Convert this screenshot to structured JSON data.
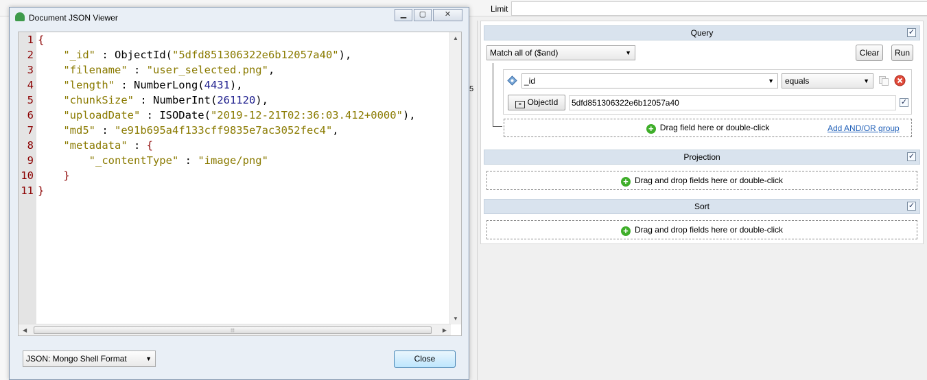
{
  "background": {
    "limit_label": "Limit",
    "mid_glyph": "5"
  },
  "query": {
    "section_label": "Query",
    "match_dropdown": "Match all of ($and)",
    "clear_label": "Clear",
    "run_label": "Run",
    "field_value": "_id",
    "operator_value": "equals",
    "type_button_label": "ObjectId",
    "value_text": "5dfd851306322e6b12057a40",
    "drag_field_text": "Drag field here or double-click",
    "add_group_link": "Add AND/OR group"
  },
  "projection": {
    "section_label": "Projection",
    "dropzone_text": "Drag and drop fields here or double-click"
  },
  "sort": {
    "section_label": "Sort",
    "dropzone_text": "Drag and drop fields here or double-click"
  },
  "dialog": {
    "title": "Document JSON Viewer",
    "format_dropdown": "JSON: Mongo Shell Format",
    "close_label": "Close",
    "line_numbers": [
      "1",
      "2",
      "3",
      "4",
      "5",
      "6",
      "7",
      "8",
      "9",
      "10",
      "11"
    ],
    "code": {
      "open_brace": "{",
      "id_key": "\"_id\"",
      "id_func": "ObjectId(",
      "id_val": "\"5dfd851306322e6b12057a40\"",
      "filename_key": "\"filename\"",
      "filename_val": "\"user_selected.png\"",
      "length_key": "\"length\"",
      "length_func": "NumberLong(",
      "length_val": "4431",
      "chunk_key": "\"chunkSize\"",
      "chunk_func": "NumberInt(",
      "chunk_val": "261120",
      "upload_key": "\"uploadDate\"",
      "upload_func": "ISODate(",
      "upload_val": "\"2019-12-21T02:36:03.412+0000\"",
      "md5_key": "\"md5\"",
      "md5_val": "\"e91b695a4f133cff9835e7ac3052fec4\"",
      "meta_key": "\"metadata\"",
      "ct_key": "\"_contentType\"",
      "ct_val": "\"image/png\"",
      "inner_close": "}",
      "close_brace": "}"
    }
  }
}
